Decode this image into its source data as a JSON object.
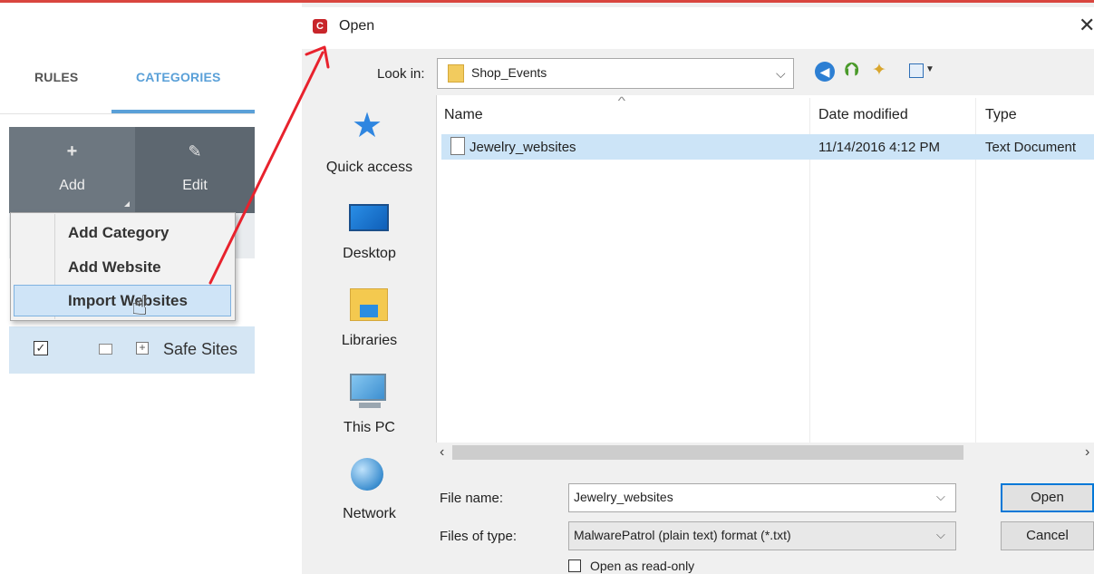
{
  "left_panel": {
    "tabs": [
      {
        "label": "RULES"
      },
      {
        "label": "CATEGORIES"
      }
    ],
    "toolbar": {
      "add_icon": "+",
      "add_label": "Add",
      "edit_icon": "✎",
      "edit_label": "Edit"
    },
    "context_menu": {
      "items": [
        {
          "label": "Add Category"
        },
        {
          "label": "Add Website"
        },
        {
          "label": "Import Websites"
        }
      ],
      "highlighted": "Import Websites"
    },
    "tree_row": {
      "checkbox_mark": "☑",
      "expand_mark": "+",
      "label": "Safe Sites"
    }
  },
  "dialog": {
    "app_icon_letter": "C",
    "title": "Open",
    "close_glyph": "✕",
    "look_in": {
      "label": "Look in:",
      "value": "Shop_Events"
    },
    "places": [
      {
        "label": "Quick access",
        "icon": "star-icon"
      },
      {
        "label": "Desktop",
        "icon": "desktop-icon"
      },
      {
        "label": "Libraries",
        "icon": "libraries-icon"
      },
      {
        "label": "This PC",
        "icon": "computer-icon"
      },
      {
        "label": "Network",
        "icon": "network-icon"
      }
    ],
    "columns": [
      "Name",
      "Date modified",
      "Type"
    ],
    "files": [
      {
        "name": "Jewelry_websites",
        "date_modified": "11/14/2016 4:12 PM",
        "type": "Text Document"
      }
    ],
    "file_name": {
      "label": "File name:",
      "value": "Jewelry_websites"
    },
    "files_of_type": {
      "label": "Files of type:",
      "value": "MalwarePatrol (plain text) format (*.txt)"
    },
    "buttons": {
      "open": "Open",
      "cancel": "Cancel"
    },
    "read_only_label": "Open as read-only"
  },
  "annotation": {
    "arrow_color": "#e8222d"
  },
  "colors": {
    "accent_blue": "#5aa0d8",
    "toolbar_bg": "#5d6770",
    "selection": "#cce4f7"
  }
}
